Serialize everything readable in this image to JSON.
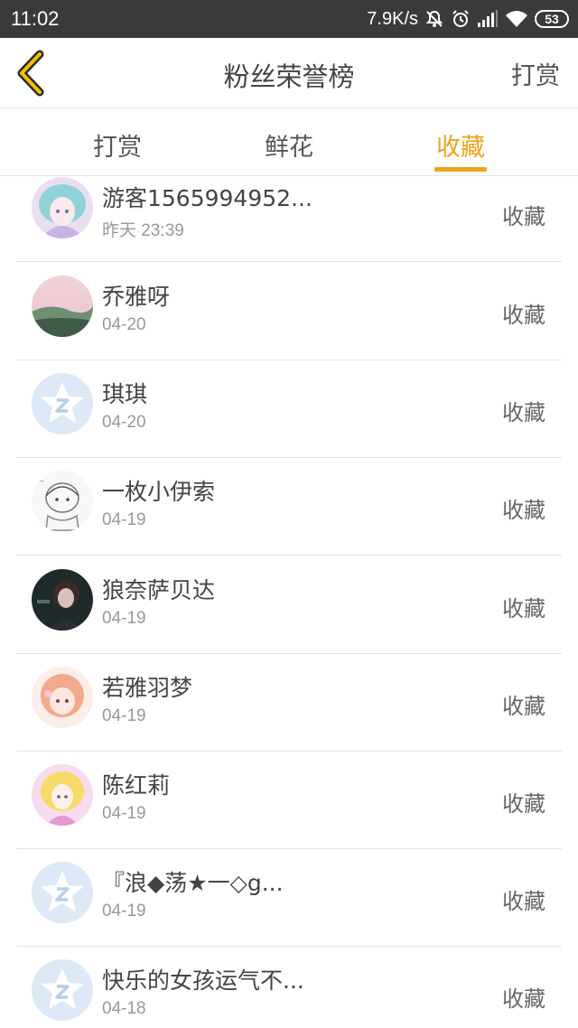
{
  "status_bar": {
    "time": "11:02",
    "network_speed": "7.9K/s",
    "battery": "53",
    "icons": [
      "mute-icon",
      "alarm-icon",
      "signal-icon",
      "wifi-icon",
      "battery-icon"
    ]
  },
  "header": {
    "back_icon": "chevron-left-icon",
    "title": "粉丝荣誉榜",
    "action_label": "打赏"
  },
  "tabs": [
    {
      "label": "打赏",
      "active": false
    },
    {
      "label": "鲜花",
      "active": false
    },
    {
      "label": "收藏",
      "active": true
    }
  ],
  "accent_color": "#f0a21b",
  "rows": [
    {
      "name": "游客1565994952...",
      "time": "昨天 23:39",
      "action": "收藏",
      "avatar": "anime-girl-teal"
    },
    {
      "name": "乔雅呀",
      "time": "04-20",
      "action": "收藏",
      "avatar": "landscape-photo"
    },
    {
      "name": "琪琪",
      "time": "04-20",
      "action": "收藏",
      "avatar": "default-star-avatar"
    },
    {
      "name": "一枚小伊索",
      "time": "04-19",
      "action": "收藏",
      "avatar": "sketch-character"
    },
    {
      "name": "狼奈萨贝达",
      "time": "04-19",
      "action": "收藏",
      "avatar": "dark-anime-girl"
    },
    {
      "name": "若雅羽梦",
      "time": "04-19",
      "action": "收藏",
      "avatar": "pink-anime-girl"
    },
    {
      "name": "陈红莉",
      "time": "04-19",
      "action": "收藏",
      "avatar": "blonde-anime-girl"
    },
    {
      "name": "『浪◆荡★一◇g...",
      "time": "04-19",
      "action": "收藏",
      "avatar": "default-star-avatar"
    },
    {
      "name": "快乐的女孩运气不...",
      "time": "04-18",
      "action": "收藏",
      "avatar": "default-star-avatar"
    }
  ]
}
